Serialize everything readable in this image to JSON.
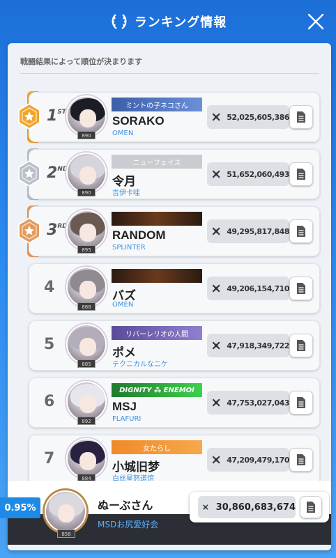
{
  "header": {
    "title": "ランキング情報"
  },
  "subtitle": "戦闘結果によって順位が決まります",
  "colors": {
    "gold": "#f2a52a",
    "silver": "#b9c0ca",
    "bronze": "#e69a5a",
    "accent_blue": "#1c8ae6"
  },
  "rows": [
    {
      "rank": "1",
      "suffix": "ST",
      "medal": "gold",
      "level": "890",
      "plate": "ミントの子ネコさん",
      "plate_style": "blue",
      "name": "SORAKO",
      "guild": "OMEN",
      "score": "52,025,605,386"
    },
    {
      "rank": "2",
      "suffix": "ND",
      "medal": "silver",
      "level": "890",
      "plate": "ニューフェイス",
      "plate_style": "gray",
      "name": "令月",
      "guild": "吉伊卡哇",
      "score": "51,652,060,493"
    },
    {
      "rank": "3",
      "suffix": "RD",
      "medal": "bronze",
      "level": "895",
      "plate": "",
      "plate_style": "ornate",
      "name": "RANDOM",
      "guild": "SPLINTER",
      "score": "49,295,817,848"
    },
    {
      "rank": "4",
      "suffix": "",
      "medal": "",
      "level": "888",
      "plate": "",
      "plate_style": "ornate",
      "name": "バズ",
      "guild": "OMEN",
      "score": "49,206,154,710"
    },
    {
      "rank": "5",
      "suffix": "",
      "medal": "",
      "level": "885",
      "plate": "リバーレリオの人間",
      "plate_style": "purple",
      "name": "ポメ",
      "guild": "テクニカルなニケ",
      "score": "47,918,349,722"
    },
    {
      "rank": "6",
      "suffix": "",
      "medal": "",
      "level": "892",
      "plate": "DIGNITY ⁂ ENEMOI",
      "plate_style": "green",
      "name": "MSJ",
      "guild": "FLAFURI",
      "score": "47,753,027,043"
    },
    {
      "rank": "7",
      "suffix": "",
      "medal": "",
      "level": "884",
      "plate": "女たらし",
      "plate_style": "orange",
      "name": "小城旧梦",
      "guild": "白丝星怒道馆",
      "score": "47,209,479,170"
    }
  ],
  "me": {
    "percent": "0.95%",
    "level": "858",
    "name": "ぬーぶさん",
    "guild": "MSDお尻愛好会",
    "score": "30,860,683,674"
  }
}
